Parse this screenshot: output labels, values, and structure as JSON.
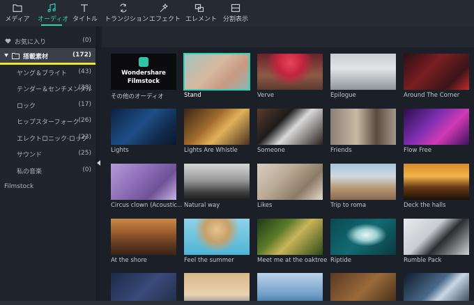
{
  "toolbar": {
    "items": [
      {
        "label": "メディア",
        "icon": "folder-icon"
      },
      {
        "label": "オーディオ",
        "icon": "music-note-icon"
      },
      {
        "label": "タイトル",
        "icon": "text-icon"
      },
      {
        "label": "トランジション",
        "icon": "transition-icon"
      },
      {
        "label": "エフェクト",
        "icon": "effects-sparkle-icon"
      },
      {
        "label": "エレメント",
        "icon": "element-icon"
      },
      {
        "label": "分割表示",
        "icon": "split-screen-icon"
      }
    ],
    "active": "オーディオ",
    "accent": "#2fd3b8"
  },
  "sidebar": {
    "favorites": {
      "label": "お気に入り",
      "count": "(0)"
    },
    "builtin": {
      "label": "搭載素材",
      "count": "(172)"
    },
    "categories": [
      {
        "label": "ヤング＆ブライト",
        "count": "(43)"
      },
      {
        "label": "テンダー＆センチメンタル",
        "count": "(38)"
      },
      {
        "label": "ロック",
        "count": "(17)"
      },
      {
        "label": "ヒップスターフォーク",
        "count": "(26)"
      },
      {
        "label": "エレクトロニック·ロック",
        "count": "(23)"
      },
      {
        "label": "サウンド",
        "count": "(25)"
      },
      {
        "label": "私の音楽",
        "count": "(0)"
      }
    ],
    "filmstock": "Filmstock",
    "highlight_color": "#f4e526"
  },
  "grid": {
    "logo_line1": "Wondershare",
    "logo_line2": "Filmstock",
    "tiles": [
      {
        "label": "その他のオーディオ"
      },
      {
        "label": "Stand"
      },
      {
        "label": "Verve"
      },
      {
        "label": "Epilogue"
      },
      {
        "label": "Around The Corner"
      },
      {
        "label": "Lights"
      },
      {
        "label": "Lights Are Whistle"
      },
      {
        "label": "Someone"
      },
      {
        "label": "Friends"
      },
      {
        "label": "Flow Free"
      },
      {
        "label": "Circus clown (Acoustic..."
      },
      {
        "label": "Natural way"
      },
      {
        "label": "Likes"
      },
      {
        "label": "Trip to roma"
      },
      {
        "label": "Deck the halls"
      },
      {
        "label": "At the shore"
      },
      {
        "label": "Feel the summer"
      },
      {
        "label": "Meet me at the oaktree"
      },
      {
        "label": "Riptide"
      },
      {
        "label": "Rumble Pack"
      },
      {
        "label": ""
      },
      {
        "label": ""
      },
      {
        "label": ""
      },
      {
        "label": ""
      },
      {
        "label": ""
      }
    ],
    "selected": "Stand"
  }
}
